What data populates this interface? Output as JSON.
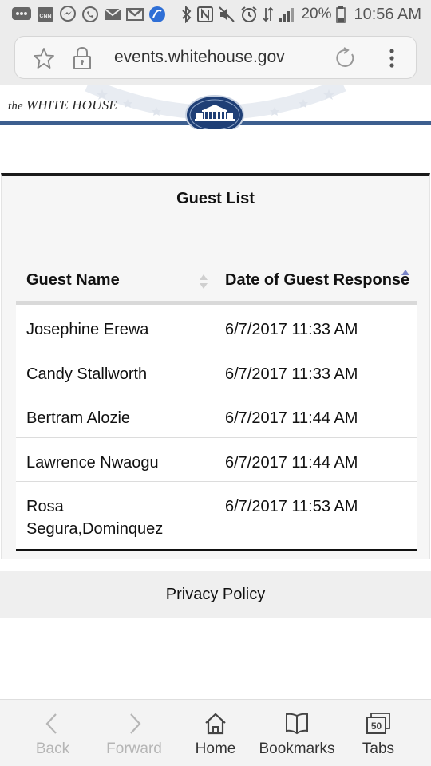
{
  "status_bar": {
    "battery": "20%",
    "time": "10:56 AM",
    "app_icons": [
      "messages-icon",
      "cnn-icon",
      "messenger-icon",
      "whatsapp-icon",
      "email-icon",
      "gmail-icon",
      "browser-app-icon"
    ],
    "system_icons": [
      "bluetooth-icon",
      "nfc-icon",
      "mute-icon",
      "alarm-icon",
      "data-icon",
      "signal-icon",
      "battery-icon"
    ]
  },
  "address_bar": {
    "url": "events.whitehouse.gov"
  },
  "site": {
    "wordmark_prefix": "the",
    "wordmark_name": "WHITE HOUSE"
  },
  "guest_list": {
    "title": "Guest List",
    "columns": [
      "Guest Name",
      "Date of Guest Response"
    ],
    "rows": [
      {
        "name": "Josephine Erewa",
        "date": "6/7/2017 11:33 AM"
      },
      {
        "name": "Candy Stallworth",
        "date": "6/7/2017 11:33 AM"
      },
      {
        "name": "Bertram Alozie",
        "date": "6/7/2017 11:44 AM"
      },
      {
        "name": "Lawrence Nwaogu",
        "date": "6/7/2017 11:44 AM"
      },
      {
        "name": "Rosa Segura,Dominquez",
        "date": "6/7/2017 11:53 AM"
      }
    ]
  },
  "footer": {
    "privacy_label": "Privacy Policy"
  },
  "bottom_nav": {
    "back": "Back",
    "forward": "Forward",
    "home": "Home",
    "bookmarks": "Bookmarks",
    "tabs": "Tabs",
    "tab_count": "50"
  },
  "colors": {
    "header_line": "#3d5f8f",
    "seal_blue": "#1f3f76"
  }
}
